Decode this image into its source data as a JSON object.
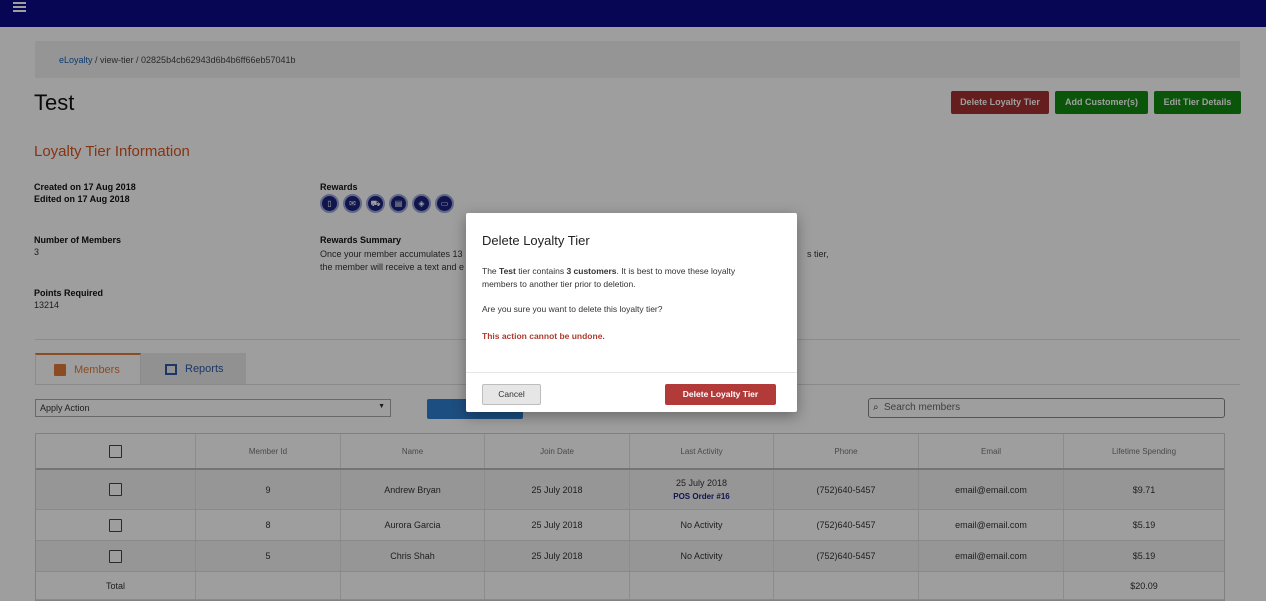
{
  "breadcrumb": {
    "root": "eLoyalty",
    "rest": " / view-tier / 02825b4cb62943d6b4b6ff66eb57041b"
  },
  "page": {
    "title": "Test"
  },
  "actions": {
    "delete_label": "Delete Loyalty Tier",
    "add_label": "Add Customer(s)",
    "edit_label": "Edit Tier Details"
  },
  "info": {
    "section_title": "Loyalty Tier Information",
    "created": "Created on 17 Aug 2018",
    "edited": "Edited on 17 Aug 2018",
    "members_label": "Number of Members",
    "members_value": "3",
    "points_label": "Points Required",
    "points_value": "13214",
    "rewards_label": "Rewards",
    "rewards_icons": [
      "mobile-icon",
      "email-icon",
      "car-icon",
      "receipt-icon",
      "tag-icon",
      "display-icon"
    ],
    "summary_label": "Rewards Summary",
    "summary_line1": "Once your member accumulates 13",
    "summary_line1_tail": "s tier,",
    "summary_line2": "the member will receive a text and e"
  },
  "tabs": {
    "members": "Members",
    "reports": "Reports"
  },
  "toolbar": {
    "apply_action": "Apply Action",
    "search_placeholder": "Search members"
  },
  "table": {
    "headers": [
      "Member Id",
      "Name",
      "Join Date",
      "Last Activity",
      "Phone",
      "Email",
      "Lifetime Spending"
    ],
    "rows": [
      {
        "id": "9",
        "name": "Andrew Bryan",
        "join": "25 July 2018",
        "activity": "25 July 2018",
        "activity_link": "POS Order #16",
        "phone": "(752)640-5457",
        "email": "email@email.com",
        "spending": "$9.71"
      },
      {
        "id": "8",
        "name": "Aurora Garcia",
        "join": "25 July 2018",
        "activity": "No Activity",
        "phone": "(752)640-5457",
        "email": "email@email.com",
        "spending": "$5.19"
      },
      {
        "id": "5",
        "name": "Chris Shah",
        "join": "25 July 2018",
        "activity": "No Activity",
        "phone": "(752)640-5457",
        "email": "email@email.com",
        "spending": "$5.19"
      }
    ],
    "total_label": "Total",
    "total_value": "$20.09"
  },
  "modal": {
    "title": "Delete Loyalty Tier",
    "p1_a": "The ",
    "p1_tier": "Test",
    "p1_b": " tier contains ",
    "p1_count": "3 customers",
    "p1_c": ". It is best to move these loyalty members to another tier prior to deletion.",
    "p2": "Are you sure you want to delete this loyalty tier?",
    "warning": "This action cannot be undone.",
    "cancel_label": "Cancel",
    "confirm_label": "Delete Loyalty Tier"
  }
}
